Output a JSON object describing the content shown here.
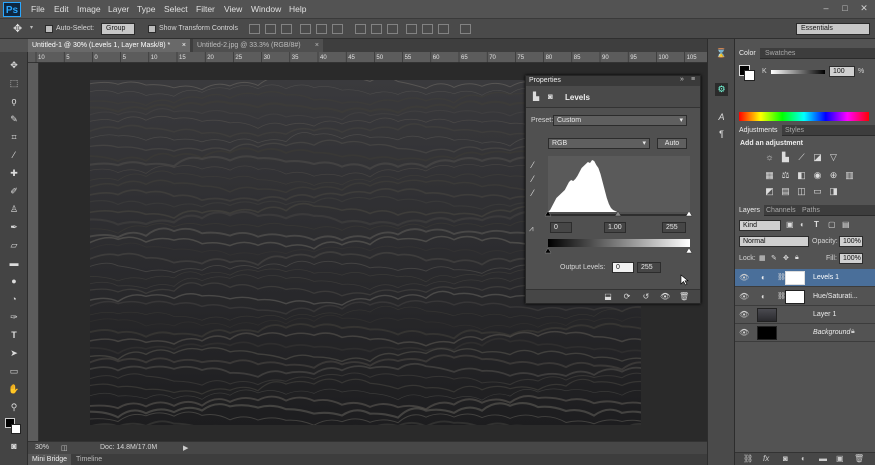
{
  "app": {
    "logo": "Ps",
    "menus": [
      "File",
      "Edit",
      "Image",
      "Layer",
      "Type",
      "Select",
      "Filter",
      "View",
      "Window",
      "Help"
    ],
    "window_buttons": [
      "–",
      "□",
      "✕"
    ]
  },
  "options": {
    "auto_select_label": "Auto-Select:",
    "group_value": "Group",
    "transform_label": "Show Transform Controls",
    "workspace": "Essentials"
  },
  "tabs": [
    {
      "label": "Untitled-1 @ 30% (Levels 1, Layer Mask/8) *",
      "close": "×"
    },
    {
      "label": "Untitled-2.jpg @ 33.3% (RGB/8#)",
      "close": "×"
    }
  ],
  "ruler": {
    "h": [
      "10",
      "5",
      "0",
      "5",
      "10",
      "15",
      "20",
      "25",
      "30",
      "35",
      "40",
      "45",
      "50",
      "55",
      "60",
      "65",
      "70",
      "75",
      "80",
      "85",
      "90",
      "95",
      "100",
      "105"
    ]
  },
  "status": {
    "zoom": "30%",
    "doc": "Doc: 14.8M/17.0M"
  },
  "bottom_tabs": [
    "Mini Bridge",
    "Timeline"
  ],
  "color_panel": {
    "tabs": [
      "Color",
      "Swatches"
    ],
    "channel": "K",
    "value": "100",
    "percent": "%"
  },
  "adjustments_panel": {
    "tabs": [
      "Adjustments",
      "Styles"
    ],
    "title": "Add an adjustment"
  },
  "layers_panel": {
    "tabs": [
      "Layers",
      "Channels",
      "Paths"
    ],
    "kind": "Kind",
    "blend_mode": "Normal",
    "opacity_label": "Opacity:",
    "opacity": "100%",
    "lock_label": "Lock:",
    "fill_label": "Fill:",
    "fill": "100%",
    "layers": [
      {
        "name": "Levels 1",
        "selected": true
      },
      {
        "name": "Hue/Saturati...",
        "selected": false
      },
      {
        "name": "Layer 1",
        "selected": false
      },
      {
        "name": "Background",
        "selected": false
      }
    ]
  },
  "properties": {
    "tab": "Properties",
    "title": "Levels",
    "preset_label": "Preset:",
    "preset_value": "Custom",
    "channel": "RGB",
    "auto_label": "Auto",
    "input_black": "0",
    "input_gamma": "1.00",
    "input_white": "255",
    "output_label": "Output Levels:",
    "output_black": "0",
    "output_white": "255"
  },
  "colors": {
    "accent": "#4a6f9a",
    "ps_blue": "#2aa7ff"
  }
}
